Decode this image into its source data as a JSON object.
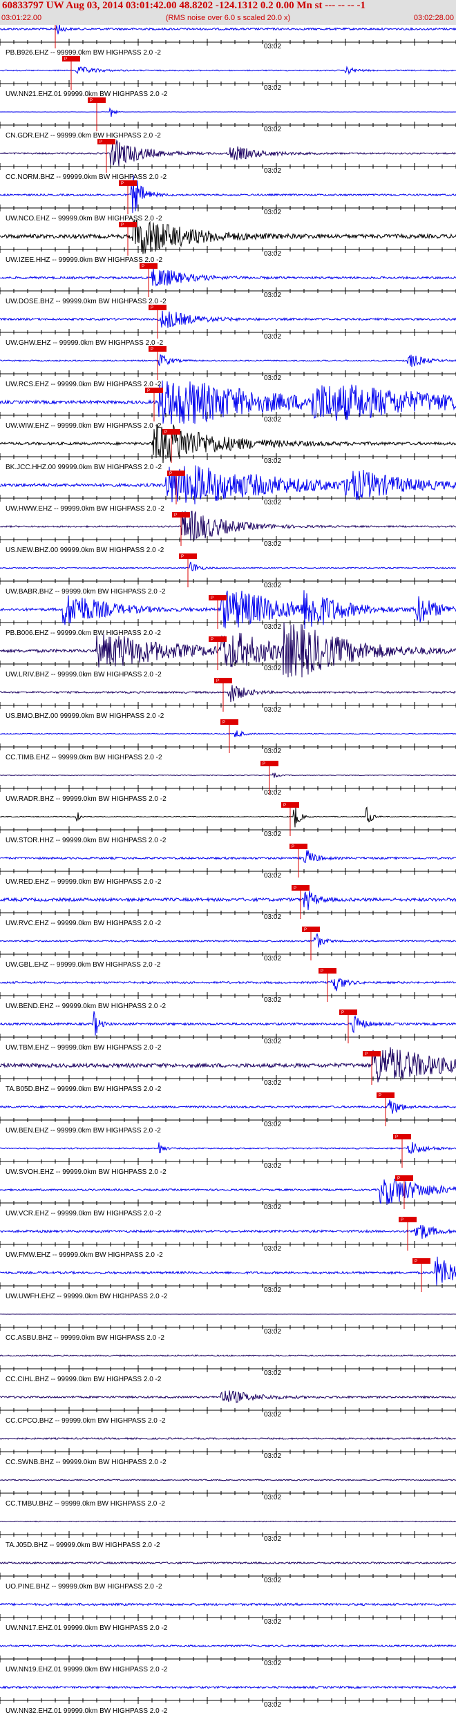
{
  "header": {
    "title": "60833797 UW Aug 03, 2014 03:01:42.00   48.8202 -124.1312  0.2 0.00 Mn st --- -- --  -1",
    "start_time": "03:01:22.00",
    "end_time": "03:02:28.00",
    "note": "(RMS noise over 6.0 s scaled 20.0 x)"
  },
  "colors": {
    "blue": "#0000ee",
    "navy": "#1a0060",
    "black": "#000000",
    "pick": "#dd0000",
    "header_bg": "#e0e0e0",
    "header_text": "#cc0000"
  },
  "chart_data": {
    "type": "seismogram",
    "x_range_seconds": [
      0,
      66
    ],
    "time_axis_label": "03:02",
    "time_axis_tick_second": 38,
    "pick_label": "P",
    "traces": [
      {
        "label": "PB.B926.EHZ -- 99999.0km BW  HIGHPASS  2.0 -2",
        "color": "blue",
        "pick": 8.0,
        "amp": 0.45,
        "bursts": [
          [
            8.2,
            1.0,
            0.7
          ]
        ]
      },
      {
        "label": "UW.NN21.EHZ.01 99999.0km BW  HIGHPASS  2.0 -2",
        "color": "blue",
        "pick": 10.3,
        "amp": 0.25,
        "bursts": [
          [
            11,
            4,
            0.4
          ],
          [
            50,
            2,
            0.4
          ]
        ]
      },
      {
        "label": "CN.GDR.EHZ -- 99999.0km BW  HIGHPASS  2.0 -2",
        "color": "blue",
        "pick": 14.0,
        "amp": 0.05,
        "bursts": [
          [
            15.8,
            0.8,
            0.9
          ]
        ]
      },
      {
        "label": "CC.NORM.BHZ -- 99999.0km BW  HIGHPASS  2.0 -2",
        "color": "navy",
        "pick": 15.4,
        "amp": 0.35,
        "bursts": [
          [
            16,
            6,
            1.6
          ],
          [
            33,
            6,
            0.8
          ]
        ]
      },
      {
        "label": "UW.NCO.EHZ -- 99999.0km BW  HIGHPASS  2.0 -2",
        "color": "blue",
        "pick": 18.5,
        "amp": 0.4,
        "bursts": [
          [
            19,
            2,
            2.5
          ]
        ]
      },
      {
        "label": "UW.IZEE.HHZ -- 99999.0km BW  HIGHPASS  2.0 -2",
        "color": "black",
        "pick": 18.5,
        "amp": 0.9,
        "bursts": [
          [
            19.2,
            10,
            2.2
          ]
        ]
      },
      {
        "label": "UW.DOSE.BHZ -- 99999.0km BW  HIGHPASS  2.0 -2",
        "color": "blue",
        "pick": 21.5,
        "amp": 0.5,
        "bursts": [
          [
            22,
            6,
            1.2
          ]
        ]
      },
      {
        "label": "UW.GHW.EHZ -- 99999.0km BW  HIGHPASS  2.0 -2",
        "color": "blue",
        "pick": 22.8,
        "amp": 0.45,
        "bursts": [
          [
            23,
            6,
            1.1
          ]
        ]
      },
      {
        "label": "UW.RCS.EHZ -- 99999.0km BW  HIGHPASS  2.0 -2",
        "color": "blue",
        "pick": 22.8,
        "amp": 0.3,
        "bursts": [
          [
            23,
            2,
            0.8
          ],
          [
            59,
            3,
            0.8
          ]
        ]
      },
      {
        "label": "UW.WIW.EHZ -- 99999.0km BW  HIGHPASS  2.0 -2",
        "color": "blue",
        "pick": 22.3,
        "amp": 0.7,
        "bursts": [
          [
            23,
            20,
            2.8
          ],
          [
            45,
            25,
            1.8
          ]
        ]
      },
      {
        "label": "BK.JCC.HHZ.00 99999.0km BW  HIGHPASS  2.0 -2",
        "color": "black",
        "pick": 24.8,
        "amp": 0.6,
        "bursts": [
          [
            22,
            12,
            2.4
          ]
        ]
      },
      {
        "label": "UW.HWW.EHZ -- 99999.0km BW  HIGHPASS  2.0 -2",
        "color": "blue",
        "pick": 25.5,
        "amp": 0.7,
        "bursts": [
          [
            24,
            20,
            2.4
          ],
          [
            50,
            10,
            1.5
          ]
        ]
      },
      {
        "label": "US.NEW.BHZ.00 99999.0km BW  HIGHPASS  2.0 -2",
        "color": "navy",
        "pick": 26.2,
        "amp": 0.35,
        "bursts": [
          [
            26.3,
            8,
            2.0
          ]
        ]
      },
      {
        "label": "UW.BABR.BHZ -- 99999.0km BW  HIGHPASS  2.0 -2",
        "color": "blue",
        "pick": 27.2,
        "amp": 0.25,
        "bursts": [
          [
            27.5,
            1.5,
            0.8
          ]
        ]
      },
      {
        "label": "PB.B006.EHZ -- 99999.0km BW  HIGHPASS  2.0 -2",
        "color": "blue",
        "pick": 31.5,
        "amp": 0.6,
        "bursts": [
          [
            9,
            8,
            2.0
          ],
          [
            32,
            12,
            2.4
          ],
          [
            44,
            6,
            2.0
          ],
          [
            60,
            4,
            1.6
          ]
        ]
      },
      {
        "label": "UW.LRIV.BHZ -- 99999.0km BW  HIGHPASS  2.0 -2",
        "color": "navy",
        "pick": 31.5,
        "amp": 0.7,
        "bursts": [
          [
            14,
            14,
            2.0
          ],
          [
            32,
            10,
            2.0
          ],
          [
            41,
            12,
            2.8
          ]
        ]
      },
      {
        "label": "US.BMO.BHZ.00 99999.0km BW  HIGHPASS  2.0 -2",
        "color": "navy",
        "pick": 32.3,
        "amp": 0.4,
        "bursts": [
          [
            33,
            3,
            1.2
          ]
        ]
      },
      {
        "label": "CC.TIMB.EHZ -- 99999.0km BW  HIGHPASS  2.0 -2",
        "color": "blue",
        "pick": 33.2,
        "amp": 0.2,
        "bursts": [
          [
            34,
            1.5,
            0.5
          ]
        ]
      },
      {
        "label": "UW.RADR.BHZ -- 99999.0km BW  HIGHPASS  2.0 -2",
        "color": "navy",
        "pick": 39.0,
        "amp": 0.15,
        "bursts": [
          [
            39.5,
            1,
            0.3
          ]
        ]
      },
      {
        "label": "UW.STOR.HHZ -- 99999.0km BW  HIGHPASS  2.0 -2",
        "color": "black",
        "pick": 42.0,
        "amp": 0.2,
        "bursts": [
          [
            42.5,
            1,
            1.6
          ],
          [
            53,
            0.8,
            1.6
          ],
          [
            11,
            0.6,
            1.2
          ]
        ]
      },
      {
        "label": "UW.RED.EHZ -- 99999.0km BW  HIGHPASS  2.0 -2",
        "color": "blue",
        "pick": 43.2,
        "amp": 0.45,
        "bursts": [
          [
            44,
            2,
            1.0
          ]
        ]
      },
      {
        "label": "UW.RVC.EHZ -- 99999.0km BW  HIGHPASS  2.0 -2",
        "color": "blue",
        "pick": 43.5,
        "amp": 0.7,
        "bursts": [
          [
            44,
            2,
            1.3
          ]
        ]
      },
      {
        "label": "UW.GBL.EHZ -- 99999.0km BW  HIGHPASS  2.0 -2",
        "color": "blue",
        "pick": 45.0,
        "amp": 0.35,
        "bursts": [
          [
            45.5,
            1.5,
            1.0
          ]
        ]
      },
      {
        "label": "UW.BEND.EHZ -- 99999.0km BW  HIGHPASS  2.0 -2",
        "color": "blue",
        "pick": 47.4,
        "amp": 0.45,
        "bursts": [
          [
            48,
            2,
            1.2
          ]
        ]
      },
      {
        "label": "UW.TBM.EHZ -- 99999.0km BW  HIGHPASS  2.0 -2",
        "color": "blue",
        "pick": 50.4,
        "amp": 0.5,
        "bursts": [
          [
            13.5,
            1,
            1.6
          ],
          [
            51,
            2,
            1.0
          ]
        ]
      },
      {
        "label": "TA.B05D.BHZ -- 99999.0km BW  HIGHPASS  2.0 -2",
        "color": "navy",
        "pick": 53.8,
        "amp": 0.9,
        "bursts": [
          [
            54,
            12,
            2.2
          ]
        ]
      },
      {
        "label": "UW.BEN.EHZ -- 99999.0km BW  HIGHPASS  2.0 -2",
        "color": "blue",
        "pick": 55.8,
        "amp": 0.45,
        "bursts": [
          [
            56,
            2,
            1.2
          ]
        ]
      },
      {
        "label": "UW.SVOH.EHZ -- 99999.0km BW  HIGHPASS  2.0 -2",
        "color": "blue",
        "pick": 58.2,
        "amp": 0.3,
        "bursts": [
          [
            23,
            0.8,
            0.9
          ],
          [
            59,
            3,
            0.8
          ]
        ]
      },
      {
        "label": "UW.VCR.EHZ -- 99999.0km BW  HIGHPASS  2.0 -2",
        "color": "blue",
        "pick": 58.5,
        "amp": 0.4,
        "bursts": [
          [
            55,
            8,
            1.8
          ]
        ]
      },
      {
        "label": "UW.FMW.EHZ -- 99999.0km BW  HIGHPASS  2.0 -2",
        "color": "blue",
        "pick": 59.0,
        "amp": 0.5,
        "bursts": [
          [
            60,
            3,
            1.2
          ]
        ]
      },
      {
        "label": "UW.UWFH.EHZ -- 99999.0km BW  HIGHPASS  2.0 -2",
        "color": "blue",
        "pick": 61.0,
        "amp": 0.5,
        "bursts": [
          [
            63,
            4,
            2.0
          ]
        ]
      },
      {
        "label": "CC.ASBU.BHZ -- 99999.0km BW  HIGHPASS  2.0 -2",
        "color": "navy",
        "pick": null,
        "amp": 0.03,
        "bursts": []
      },
      {
        "label": "CC.CIHL.BHZ -- 99999.0km BW  HIGHPASS  2.0 -2",
        "color": "navy",
        "pick": null,
        "amp": 0.3,
        "bursts": []
      },
      {
        "label": "CC.CPCO.BHZ -- 99999.0km BW  HIGHPASS  2.0 -2",
        "color": "navy",
        "pick": null,
        "amp": 0.45,
        "bursts": [
          [
            32,
            6,
            0.8
          ]
        ]
      },
      {
        "label": "CC.SWNB.BHZ -- 99999.0km BW  HIGHPASS  2.0 -2",
        "color": "navy",
        "pick": null,
        "amp": 0.35,
        "bursts": []
      },
      {
        "label": "CC.TMBU.BHZ -- 99999.0km BW  HIGHPASS  2.0 -2",
        "color": "navy",
        "pick": null,
        "amp": 0.25,
        "bursts": []
      },
      {
        "label": "TA.J05D.BHZ -- 99999.0km BW  HIGHPASS  2.0 -2",
        "color": "navy",
        "pick": null,
        "amp": 0.2,
        "bursts": []
      },
      {
        "label": "UO.PINE.BHZ -- 99999.0km BW  HIGHPASS  2.0 -2",
        "color": "navy",
        "pick": null,
        "amp": 0.4,
        "bursts": []
      },
      {
        "label": "UW.NN17.EHZ.01 99999.0km BW  HIGHPASS  2.0 -2",
        "color": "blue",
        "pick": null,
        "amp": 0.5,
        "bursts": []
      },
      {
        "label": "UW.NN19.EHZ.01 99999.0km BW  HIGHPASS  2.0 -2",
        "color": "blue",
        "pick": null,
        "amp": 0.4,
        "bursts": []
      },
      {
        "label": "UW.NN32.EHZ.01 99999.0km BW  HIGHPASS  2.0 -2",
        "color": "blue",
        "pick": null,
        "amp": 0.45,
        "bursts": []
      }
    ]
  }
}
